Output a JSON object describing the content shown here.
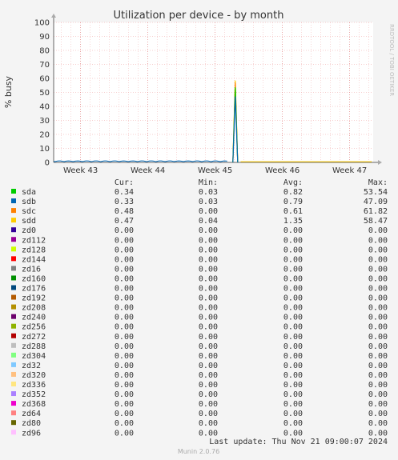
{
  "chart_data": {
    "type": "line",
    "title": "Utilization per device - by month",
    "ylabel": "% busy",
    "ylim": [
      0,
      100
    ],
    "yticks": [
      0,
      10,
      20,
      30,
      40,
      50,
      60,
      70,
      80,
      90,
      100
    ],
    "xticks": [
      "Week 43",
      "Week 44",
      "Week 45",
      "Week 46",
      "Week 47"
    ],
    "grid": true,
    "series": [
      {
        "name": "sda",
        "color": "#00cc00",
        "cur": "0.34",
        "min": "0.03",
        "avg": "0.82",
        "max": "53.54"
      },
      {
        "name": "sdb",
        "color": "#0066b3",
        "cur": "0.33",
        "min": "0.03",
        "avg": "0.79",
        "max": "47.09"
      },
      {
        "name": "sdc",
        "color": "#ff8000",
        "cur": "0.48",
        "min": "0.00",
        "avg": "0.61",
        "max": "61.82"
      },
      {
        "name": "sdd",
        "color": "#ffcc00",
        "cur": "0.47",
        "min": "0.04",
        "avg": "1.35",
        "max": "58.47"
      },
      {
        "name": "zd0",
        "color": "#330099",
        "cur": "0.00",
        "min": "0.00",
        "avg": "0.00",
        "max": "0.00"
      },
      {
        "name": "zd112",
        "color": "#990099",
        "cur": "0.00",
        "min": "0.00",
        "avg": "0.00",
        "max": "0.00"
      },
      {
        "name": "zd128",
        "color": "#ccff00",
        "cur": "0.00",
        "min": "0.00",
        "avg": "0.00",
        "max": "0.00"
      },
      {
        "name": "zd144",
        "color": "#ff0000",
        "cur": "0.00",
        "min": "0.00",
        "avg": "0.00",
        "max": "0.00"
      },
      {
        "name": "zd16",
        "color": "#808080",
        "cur": "0.00",
        "min": "0.00",
        "avg": "0.00",
        "max": "0.00"
      },
      {
        "name": "zd160",
        "color": "#008f00",
        "cur": "0.00",
        "min": "0.00",
        "avg": "0.00",
        "max": "0.00"
      },
      {
        "name": "zd176",
        "color": "#00487d",
        "cur": "0.00",
        "min": "0.00",
        "avg": "0.00",
        "max": "0.00"
      },
      {
        "name": "zd192",
        "color": "#b35a00",
        "cur": "0.00",
        "min": "0.00",
        "avg": "0.00",
        "max": "0.00"
      },
      {
        "name": "zd208",
        "color": "#b38f00",
        "cur": "0.00",
        "min": "0.00",
        "avg": "0.00",
        "max": "0.00"
      },
      {
        "name": "zd240",
        "color": "#6b006b",
        "cur": "0.00",
        "min": "0.00",
        "avg": "0.00",
        "max": "0.00"
      },
      {
        "name": "zd256",
        "color": "#8fb300",
        "cur": "0.00",
        "min": "0.00",
        "avg": "0.00",
        "max": "0.00"
      },
      {
        "name": "zd272",
        "color": "#b30000",
        "cur": "0.00",
        "min": "0.00",
        "avg": "0.00",
        "max": "0.00"
      },
      {
        "name": "zd288",
        "color": "#bebebe",
        "cur": "0.00",
        "min": "0.00",
        "avg": "0.00",
        "max": "0.00"
      },
      {
        "name": "zd304",
        "color": "#80ff80",
        "cur": "0.00",
        "min": "0.00",
        "avg": "0.00",
        "max": "0.00"
      },
      {
        "name": "zd32",
        "color": "#80c9ff",
        "cur": "0.00",
        "min": "0.00",
        "avg": "0.00",
        "max": "0.00"
      },
      {
        "name": "zd320",
        "color": "#ffc080",
        "cur": "0.00",
        "min": "0.00",
        "avg": "0.00",
        "max": "0.00"
      },
      {
        "name": "zd336",
        "color": "#ffe680",
        "cur": "0.00",
        "min": "0.00",
        "avg": "0.00",
        "max": "0.00"
      },
      {
        "name": "zd352",
        "color": "#aa80ff",
        "cur": "0.00",
        "min": "0.00",
        "avg": "0.00",
        "max": "0.00"
      },
      {
        "name": "zd368",
        "color": "#ee00cc",
        "cur": "0.00",
        "min": "0.00",
        "avg": "0.00",
        "max": "0.00"
      },
      {
        "name": "zd64",
        "color": "#ff8080",
        "cur": "0.00",
        "min": "0.00",
        "avg": "0.00",
        "max": "0.00"
      },
      {
        "name": "zd80",
        "color": "#666600",
        "cur": "0.00",
        "min": "0.00",
        "avg": "0.00",
        "max": "0.00"
      },
      {
        "name": "zd96",
        "color": "#ffbfff",
        "cur": "0.00",
        "min": "0.00",
        "avg": "0.00",
        "max": "0.00"
      }
    ],
    "spikes": [
      {
        "series": "sdd",
        "x_week": 45.3,
        "value": 58.47
      },
      {
        "series": "sdc",
        "x_week": 45.3,
        "value": 57
      },
      {
        "series": "sda",
        "x_week": 45.3,
        "value": 53.54
      },
      {
        "series": "sdb",
        "x_week": 45.3,
        "value": 47.09
      }
    ],
    "x_range_weeks": [
      42.6,
      47.35
    ],
    "baseline_value": 0.5
  },
  "legend_headers": {
    "cur": "Cur:",
    "min": "Min:",
    "avg": "Avg:",
    "max": "Max:"
  },
  "last_update": "Last update:  Thu Nov 21 09:00:07 2024",
  "footer": "Munin 2.0.76",
  "watermark": "RRDTOOL / TOBI OETIKER"
}
